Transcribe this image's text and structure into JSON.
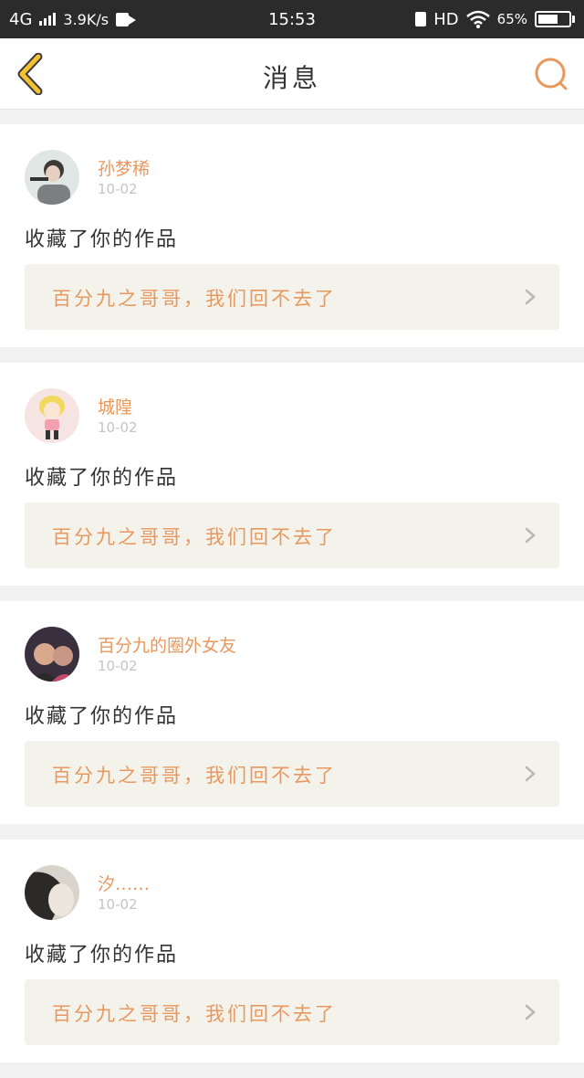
{
  "status_bar": {
    "network": "4G",
    "speed": "3.9K/s",
    "time": "15:53",
    "hd": "HD",
    "battery": "65%"
  },
  "header": {
    "title": "消息",
    "back_icon": "chevron-left-icon",
    "search_icon": "search-icon"
  },
  "colors": {
    "accent": "#e8985e",
    "back_arrow": "#f2c230",
    "card_link_bg": "#f3f3ec",
    "status_bg": "#2b2b2b"
  },
  "messages": [
    {
      "username": "孙梦稀",
      "date": "10-02",
      "action": "收藏了你的作品",
      "work_title": "百分九之哥哥，我们回不去了"
    },
    {
      "username": "城隍",
      "date": "10-02",
      "action": "收藏了你的作品",
      "work_title": "百分九之哥哥，我们回不去了"
    },
    {
      "username": "百分九的圈外女友",
      "date": "10-02",
      "action": "收藏了你的作品",
      "work_title": "百分九之哥哥，我们回不去了"
    },
    {
      "username": "汐……",
      "date": "10-02",
      "action": "收藏了你的作品",
      "work_title": "百分九之哥哥，我们回不去了"
    }
  ]
}
